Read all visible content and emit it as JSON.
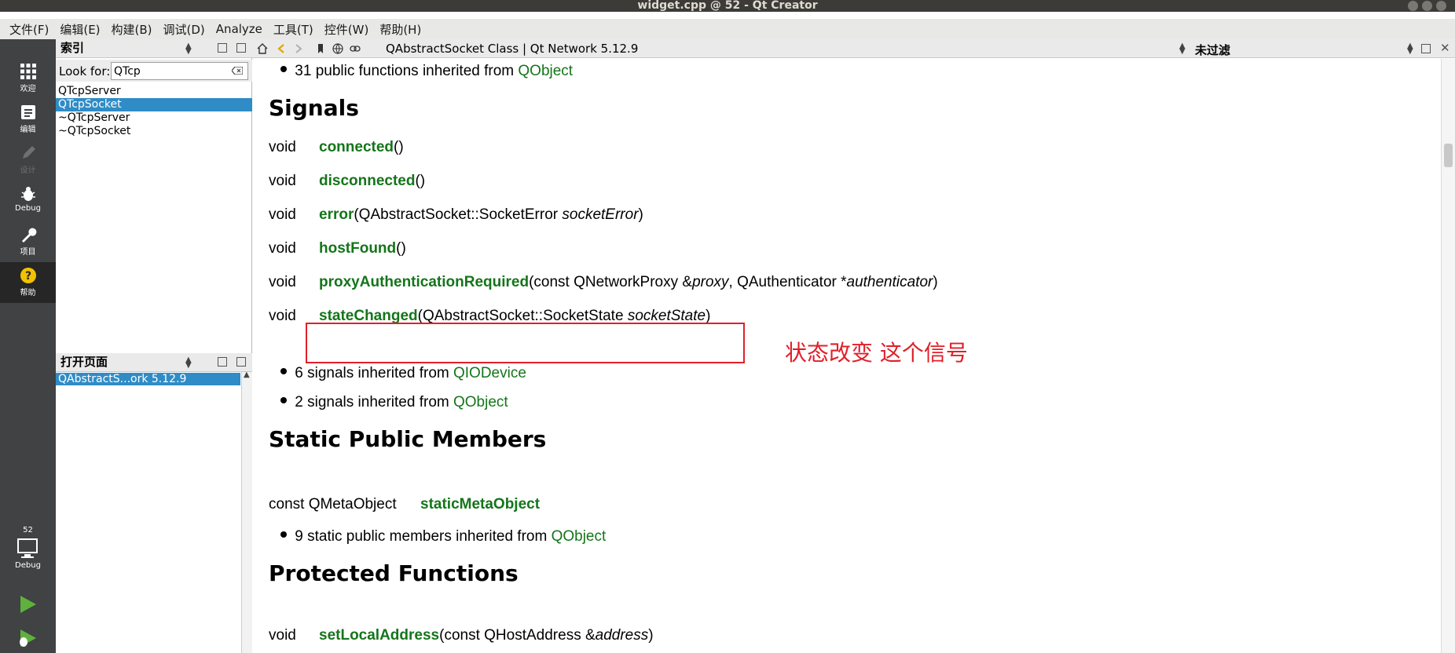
{
  "window": {
    "title": "widget.cpp @ 52 - Qt Creator"
  },
  "menubar": {
    "items": [
      "文件(F)",
      "编辑(E)",
      "构建(B)",
      "调试(D)",
      "Analyze",
      "工具(T)",
      "控件(W)",
      "帮助(H)"
    ]
  },
  "modes": [
    {
      "label": "欢迎",
      "icon": "grid-icon"
    },
    {
      "label": "编辑",
      "icon": "document-icon"
    },
    {
      "label": "设计",
      "icon": "pencil-icon"
    },
    {
      "label": "Debug",
      "icon": "bug-icon"
    },
    {
      "label": "项目",
      "icon": "wrench-icon"
    },
    {
      "label": "帮助",
      "icon": "help-icon"
    }
  ],
  "kit_selector": {
    "project_number": "52",
    "label": "Debug",
    "icon": "monitor-icon"
  },
  "sidebar": {
    "index_header": "索引",
    "lookfor_label": "Look for:",
    "lookfor_value": "QTcp",
    "index_items": [
      "QTcpServer",
      "QTcpSocket",
      "~QTcpServer",
      "~QTcpSocket"
    ],
    "open_pages_header": "打开页面",
    "open_page_item": "QAbstractS...ork 5.12.9"
  },
  "doc_toolbar": {
    "title": "QAbstractSocket Class | Qt Network 5.12.9",
    "filter": "未过滤"
  },
  "content": {
    "top_bullet": {
      "text": "31 public functions inherited from ",
      "link": "QObject"
    },
    "signals_heading": "Signals",
    "signals": [
      {
        "ret": "void",
        "name": "connected",
        "pre": "()",
        "arg": "",
        "post": ""
      },
      {
        "ret": "void",
        "name": "disconnected",
        "pre": "()",
        "arg": "",
        "post": ""
      },
      {
        "ret": "void",
        "name": "error",
        "pre": "(QAbstractSocket::SocketError ",
        "arg": "socketError",
        "post": ")"
      },
      {
        "ret": "void",
        "name": "hostFound",
        "pre": "()",
        "arg": "",
        "post": ""
      },
      {
        "ret": "void",
        "name": "proxyAuthenticationRequired",
        "pre": "(const QNetworkProxy &",
        "arg": "proxy",
        "post": ", QAuthenticator *",
        "arg2": "authenticator",
        "post2": ")"
      },
      {
        "ret": "void",
        "name": "stateChanged",
        "pre": "(QAbstractSocket::SocketState ",
        "arg": "socketState",
        "post": ")"
      }
    ],
    "signals_inherited": [
      {
        "text": "6 signals inherited from ",
        "link": "QIODevice"
      },
      {
        "text": "2 signals inherited from ",
        "link": "QObject"
      }
    ],
    "static_heading": "Static Public Members",
    "static_member": {
      "ret": "const QMetaObject",
      "name": "staticMetaObject"
    },
    "static_inherited": {
      "text": "9 static public members inherited from ",
      "link": "QObject"
    },
    "protected_heading": "Protected Functions",
    "protected": {
      "ret": "void",
      "name": "setLocalAddress",
      "pre": "(const QHostAddress &",
      "arg": "address",
      "post": ")"
    },
    "annotation": "状态改变 这个信号",
    "annotation_color": "#e0202a"
  },
  "colors": {
    "link": "#14751a",
    "selection": "#308cc6",
    "modebar": "#404244"
  }
}
